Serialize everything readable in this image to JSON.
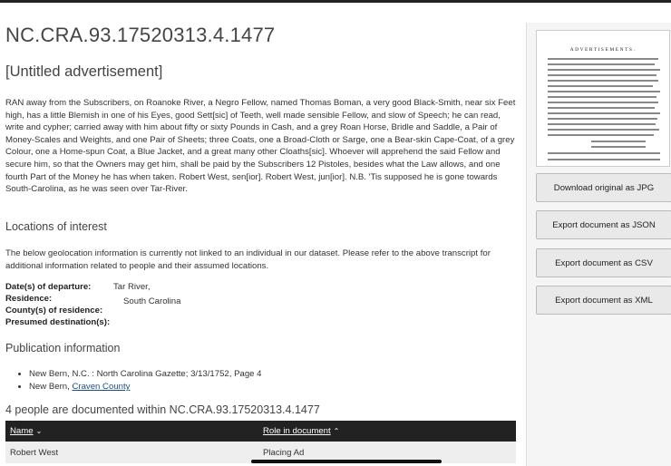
{
  "document": {
    "id": "NC.CRA.93.17520313.4.1477",
    "title": "[Untitled advertisement]",
    "transcript": "RAN away from the Subscribers, on Roanoke River, a Negro Fellow, named Thomas Boman, a very good Black-Smith, near six Feet high, has a little Blemish in one of his Eyes, good Sett[sic] of Teeth, well made sensible Fellow, and slow of Speech; he can read, write and cypher; carried away with him about fifty or sixty Pounds in Cash, and a grey Roan Horse, Bridle and Saddle, a Pair of Money-Scales and Weights, and one Pair of Sheets; three Coats, one a Broad-Cloth or Sarge, one a Bear-skin Cape-Coat, of a grey Colour, one a Home-spun Coat, a Blue Jacket, and a great many other Cloaths[sic]. Whoever will apprehend the said Fellow and secure him, so that the Owners may get him, shall be paid by the Subscribers 12 Pistoles, besides what the Law allows, and one fourth Part of the Money he has when taken. Robert West, sen[ior]. Robert West, jun[ior]. N.B. 'Tis supposed he is gone towards South-Carolina, as he was seen over Tar-River."
  },
  "locations": {
    "heading": "Locations of interest",
    "note": "The below geolocation information is currently not linked to an individual in our dataset. Please refer to the above transcript for additional information related to people and their assumed locations.",
    "facts": [
      {
        "label": "Date(s) of departure:",
        "value": "Tar River,"
      },
      {
        "label": "Residence:",
        "value": "South Carolina"
      },
      {
        "label": "County(s) of residence:",
        "value": ""
      },
      {
        "label": "Presumed destination(s):",
        "value": ""
      }
    ]
  },
  "publication": {
    "heading": "Publication information",
    "items": [
      {
        "text": "New Bern, N.C. : North Carolina Gazette; 3/13/1752, Page 4",
        "prefix": "",
        "link": ""
      },
      {
        "text": "",
        "prefix": "New Bern, ",
        "link": "Craven County"
      }
    ]
  },
  "people": {
    "heading": "4 people are documented within NC.CRA.93.17520313.4.1477",
    "columns": {
      "name": "Name",
      "role": "Role in document"
    },
    "rows": [
      {
        "name": "Robert West",
        "role": "Placing Ad"
      }
    ]
  },
  "sidebar": {
    "thumbnail_caption": "ADVERTISEMENTS.",
    "buttons": {
      "jpg": "Download original as JPG",
      "json": "Export document as JSON",
      "csv": "Export document as CSV",
      "xml": "Export document as XML"
    }
  }
}
